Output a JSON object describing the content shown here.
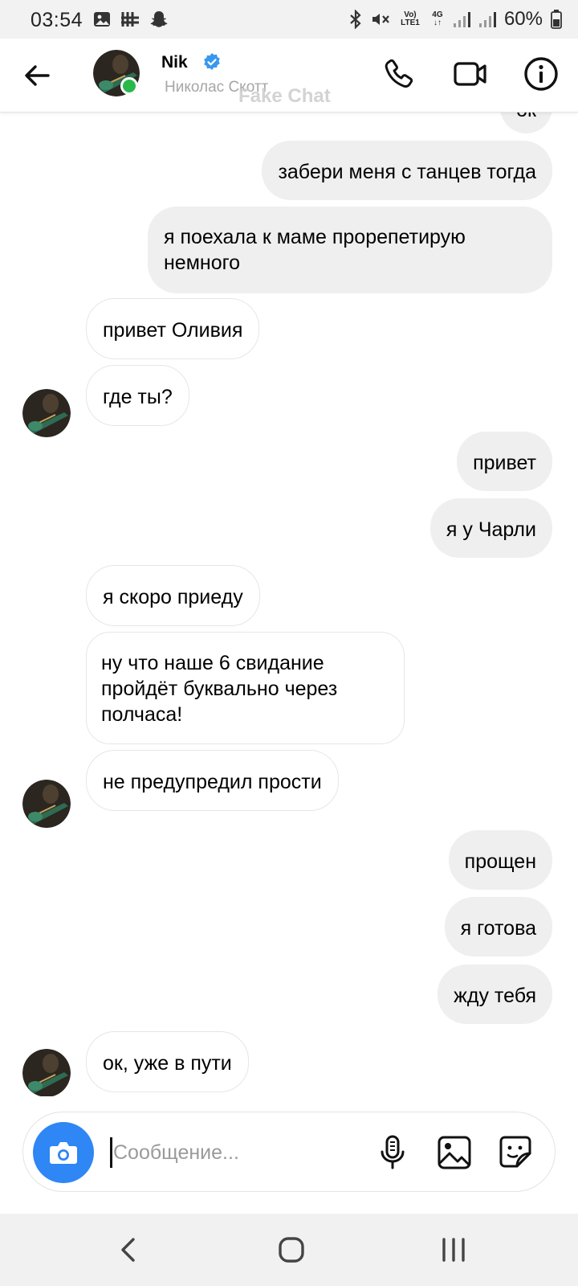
{
  "status_bar": {
    "time": "03:54",
    "battery": "60%",
    "network": "4G",
    "volte_line1": "Vo)",
    "volte_line2": "LTE1",
    "left_icons": [
      "image-notification-icon",
      "app-notification-icon",
      "snapchat-icon"
    ],
    "right_icons": [
      "bluetooth-icon",
      "mute-icon",
      "volte-icon",
      "network-4g-icon",
      "signal-icon",
      "signal-icon",
      "battery-icon"
    ]
  },
  "header": {
    "name": "Nik",
    "verified": true,
    "subtitle": "Николас Скотт",
    "watermark": "Fake Chat",
    "online": true,
    "icons": [
      "back-arrow-icon",
      "phone-icon",
      "video-camera-icon",
      "info-icon"
    ]
  },
  "messages": [
    {
      "side": "out",
      "text": "ок"
    },
    {
      "side": "out",
      "text": "забери меня с танцев тогда"
    },
    {
      "side": "out",
      "text": "я поехала к маме прорепетирую немного"
    },
    {
      "side": "in",
      "text": "привет Оливия"
    },
    {
      "side": "in",
      "text": "где ты?"
    },
    {
      "side": "out",
      "text": "привет"
    },
    {
      "side": "out",
      "text": "я у Чарли"
    },
    {
      "side": "in",
      "text": "я скоро приеду"
    },
    {
      "side": "in",
      "text": "ну что наше 6 свидание пройдёт буквально через полчаса!"
    },
    {
      "side": "in",
      "text": "не предупредил прости"
    },
    {
      "side": "out",
      "text": "прощен"
    },
    {
      "side": "out",
      "text": "я готова"
    },
    {
      "side": "out",
      "text": "жду тебя"
    },
    {
      "side": "in",
      "text": "ок, уже в пути"
    }
  ],
  "composer": {
    "placeholder": "Сообщение...",
    "value": "",
    "icons": [
      "camera-icon",
      "microphone-icon",
      "gallery-icon",
      "sticker-icon"
    ]
  },
  "nav_bar": {
    "icons": [
      "nav-back-icon",
      "nav-home-icon",
      "nav-recents-icon"
    ]
  },
  "colors": {
    "accent": "#2f86f5",
    "online": "#2ab84b",
    "verified": "#3897f0",
    "outgoing_bubble": "#efefef",
    "incoming_border": "#e6e6e6"
  }
}
